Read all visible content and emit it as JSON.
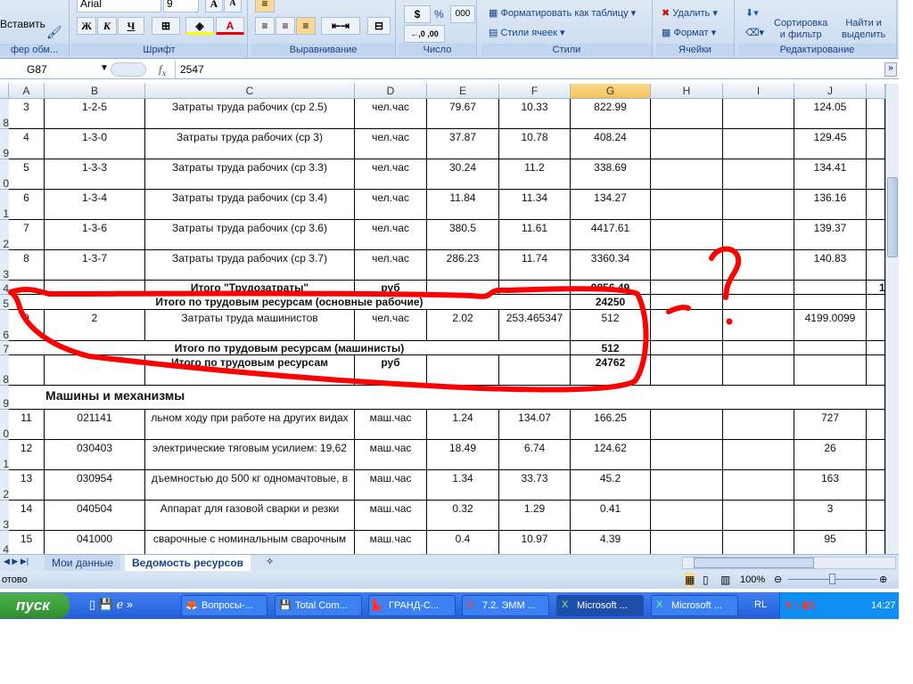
{
  "ribbon": {
    "clipboard": {
      "paste": "Вставить",
      "label": "фер обм..."
    },
    "font": {
      "name": "Arial",
      "size": "9",
      "bold": "Ж",
      "italic": "К",
      "underline": "Ч",
      "label": "Шрифт"
    },
    "alignment": {
      "label": "Выравнивание"
    },
    "number": {
      "percent": "%",
      "thousands": "000",
      "label": "Число"
    },
    "styles": {
      "format_table": "Форматировать как таблицу",
      "cell_styles": "Стили ячеек",
      "label": "Стили"
    },
    "cells": {
      "delete": "Удалить",
      "format": "Формат",
      "label": "Ячейки"
    },
    "editing": {
      "sort": "Сортировка\nи фильтр",
      "find": "Найти и\nвыделить",
      "label": "Редактирование"
    }
  },
  "formula_bar": {
    "name_box": "G87",
    "fx": "fx",
    "value": "2547"
  },
  "columns": [
    "A",
    "B",
    "C",
    "D",
    "E",
    "F",
    "G",
    "H",
    "I",
    "J"
  ],
  "selected_column": "G",
  "row_headers": [
    "8",
    "9",
    "0",
    "1",
    "2",
    "3",
    "4",
    "5",
    "6",
    "7",
    "8",
    "9",
    "0",
    "1",
    "2",
    "3",
    "4"
  ],
  "rows": [
    {
      "cells": [
        "3",
        "1-2-5",
        "Затраты труда рабочих (ср 2.5)",
        "чел.час",
        "79.67",
        "10.33",
        "822.99",
        "",
        "",
        "124.05"
      ]
    },
    {
      "cells": [
        "4",
        "1-3-0",
        "Затраты труда рабочих (ср 3)",
        "чел.час",
        "37.87",
        "10.78",
        "408.24",
        "",
        "",
        "129.45"
      ]
    },
    {
      "cells": [
        "5",
        "1-3-3",
        "Затраты труда рабочих (ср 3.3)",
        "чел.час",
        "30.24",
        "11.2",
        "338.69",
        "",
        "",
        "134.41"
      ]
    },
    {
      "cells": [
        "6",
        "1-3-4",
        "Затраты труда рабочих (ср 3.4)",
        "чел.час",
        "11.84",
        "11.34",
        "134.27",
        "",
        "",
        "136.16"
      ]
    },
    {
      "cells": [
        "7",
        "1-3-6",
        "Затраты труда рабочих (ср 3.6)",
        "чел.час",
        "380.5",
        "11.61",
        "4417.61",
        "",
        "",
        "139.37"
      ]
    },
    {
      "cells": [
        "8",
        "1-3-7",
        "Затраты труда рабочих (ср 3.7)",
        "чел.час",
        "286.23",
        "11.74",
        "3360.34",
        "",
        "",
        "140.83"
      ]
    },
    {
      "total": true,
      "label": "Итого \"Трудозатраты\"",
      "unit": "руб",
      "g": "9856.49",
      "k": "1"
    },
    {
      "merged": true,
      "label": "Итого по трудовым ресурсам (основные рабочие)",
      "g": "24250"
    },
    {
      "cells": [
        "9",
        "2",
        "Затраты труда машинистов",
        "чел.час",
        "2.02",
        "253.465347",
        "512",
        "",
        "",
        "4199.0099"
      ]
    },
    {
      "merged": true,
      "label": "Итого по трудовым ресурсам (машинисты)",
      "g": "512"
    },
    {
      "total": true,
      "label": "Итого по трудовым ресурсам",
      "unit": "руб",
      "g": "24762"
    },
    {
      "section": "Машины и механизмы"
    },
    {
      "cells": [
        "11",
        "021141",
        "льном ходу при работе на других видах",
        "маш.час",
        "1.24",
        "134.07",
        "166.25",
        "",
        "",
        "727"
      ]
    },
    {
      "cells": [
        "12",
        "030403",
        "электрические тяговым усилием: 19,62",
        "маш.час",
        "18.49",
        "6.74",
        "124.62",
        "",
        "",
        "26"
      ]
    },
    {
      "cells": [
        "13",
        "030954",
        "дъемностью до 500 кг одномачтовые, в",
        "маш.час",
        "1.34",
        "33.73",
        "45.2",
        "",
        "",
        "163"
      ]
    },
    {
      "cells": [
        "14",
        "040504",
        "Аппарат для газовой сварки и резки",
        "маш.час",
        "0.32",
        "1.29",
        "0.41",
        "",
        "",
        "3"
      ]
    },
    {
      "cells": [
        "15",
        "041000",
        "сварочные с номинальным сварочным",
        "маш.час",
        "0.4",
        "10.97",
        "4.39",
        "",
        "",
        "95"
      ]
    }
  ],
  "sheet_tabs": [
    {
      "label": "Мои данные",
      "active": false
    },
    {
      "label": "Ведомость ресурсов",
      "active": true
    }
  ],
  "status": {
    "ready": "отово",
    "zoom": "100%"
  },
  "taskbar": {
    "start": "пуск",
    "tasks": [
      {
        "label": "Вопросы-...",
        "icon": "firefox-icon"
      },
      {
        "label": "Total Com...",
        "icon": "floppy-icon"
      },
      {
        "label": "ГРАНД-С...",
        "icon": "grand-icon"
      },
      {
        "label": "7.2. ЭММ ...",
        "icon": "pdf-icon"
      },
      {
        "label": "Microsoft ...",
        "icon": "excel-icon",
        "active": true
      },
      {
        "label": "Microsoft ...",
        "icon": "excel-icon"
      }
    ],
    "lang": "RL",
    "clock": "14:27"
  },
  "annotation": {
    "mark": "?",
    "color": "#ff0000"
  }
}
